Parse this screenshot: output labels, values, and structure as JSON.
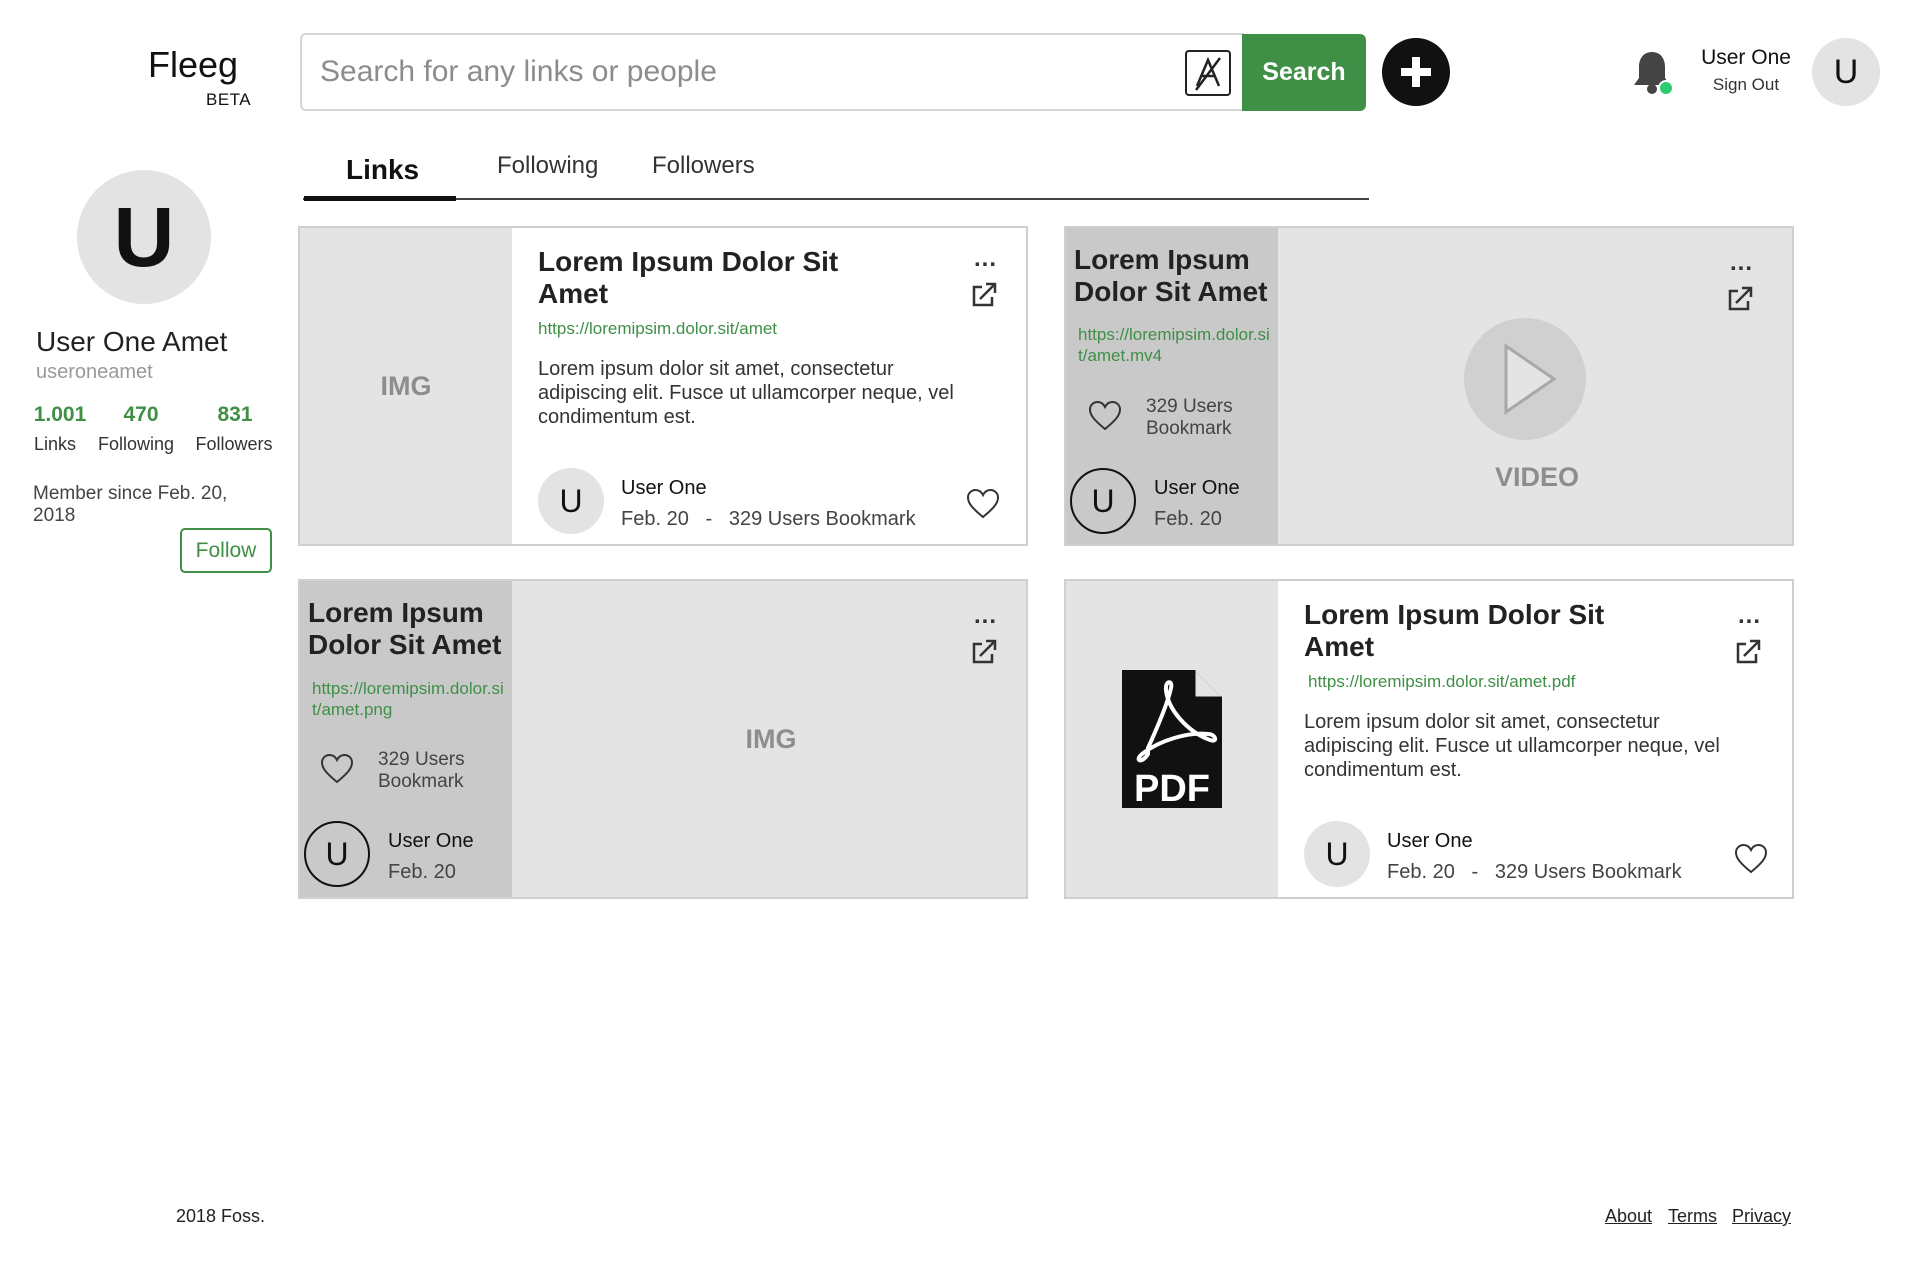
{
  "header": {
    "logo": "Fleeg",
    "beta": "BETA",
    "search_placeholder": "Search for any links or people",
    "search_label": "Search",
    "user_name": "User One",
    "sign_out": "Sign Out",
    "avatar_letter": "U"
  },
  "tabs": [
    {
      "label": "Links",
      "active": true
    },
    {
      "label": "Following",
      "active": false
    },
    {
      "label": "Followers",
      "active": false
    }
  ],
  "profile": {
    "avatar_letter": "U",
    "name": "User One Amet",
    "handle": "useroneamet",
    "stats": [
      {
        "value": "1.001",
        "label": "Links"
      },
      {
        "value": "470",
        "label": "Following"
      },
      {
        "value": "831",
        "label": "Followers"
      }
    ],
    "member_since": "Member since Feb. 20, 2018",
    "follow_label": "Follow"
  },
  "cards": [
    {
      "type": "image",
      "media_label": "IMG",
      "title": "Lorem Ipsum Dolor Sit Amet",
      "url": "https://loremipsim.dolor.sit/amet",
      "description": "Lorem ipsum dolor sit amet, consectetur adipiscing elit. Fusce ut ullamcorper neque, vel condimentum est.",
      "avatar_letter": "U",
      "user": "User One",
      "date": "Feb. 20",
      "separator": "-",
      "bookmarks": "329 Users Bookmark",
      "menu": "..."
    },
    {
      "type": "video",
      "media_label": "VIDEO",
      "title": "Lorem Ipsum Dolor Sit Amet",
      "url": "https://loremipsim.dolor.sit/amet.mv4",
      "bookmarks": "329 Users Bookmark",
      "avatar_letter": "U",
      "user": "User One",
      "date": "Feb. 20",
      "menu": "..."
    },
    {
      "type": "image-large",
      "media_label": "IMG",
      "title": "Lorem Ipsum Dolor Sit Amet",
      "url": "https://loremipsim.dolor.sit/amet.png",
      "bookmarks": "329 Users Bookmark",
      "avatar_letter": "U",
      "user": "User One",
      "date": "Feb. 20",
      "menu": "..."
    },
    {
      "type": "pdf",
      "media_label": "PDF",
      "title": "Lorem Ipsum Dolor Sit Amet",
      "url": "https://loremipsim.dolor.sit/amet.pdf",
      "description": "Lorem ipsum dolor sit amet, consectetur adipiscing elit. Fusce ut ullamcorper neque, vel condimentum est.",
      "avatar_letter": "U",
      "user": "User One",
      "date": "Feb. 20",
      "separator": "-",
      "bookmarks": "329 Users Bookmark",
      "menu": "..."
    }
  ],
  "footer": {
    "copyright": "2018 Foss.",
    "links": [
      "About",
      "Terms",
      "Privacy"
    ]
  },
  "colors": {
    "accent": "#3f8f47",
    "notification_dot": "#2ecc71",
    "placeholder_bg": "#e4e4e4",
    "panel_bg": "#c9c9c9"
  }
}
